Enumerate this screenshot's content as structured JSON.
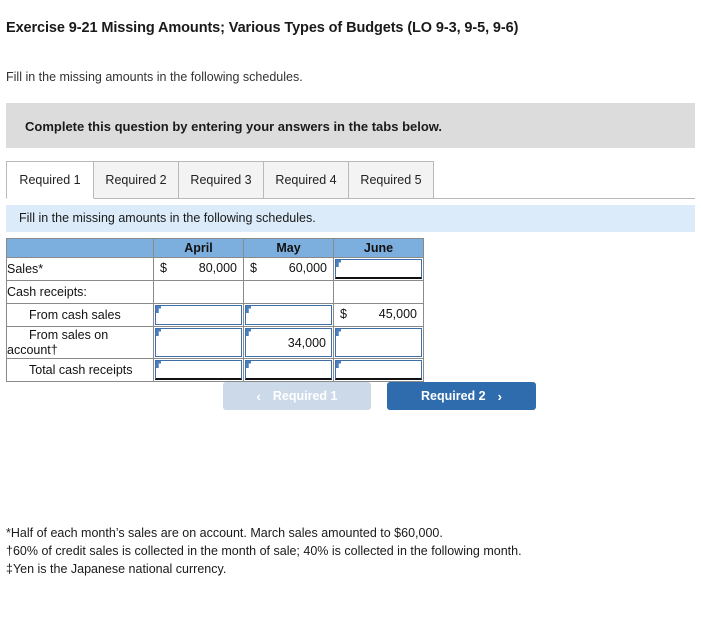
{
  "page": {
    "title": "Exercise 9-21 Missing Amounts; Various Types of Budgets (LO 9-3, 9-5, 9-6)",
    "subtitle": "Fill in the missing amounts in the following schedules."
  },
  "gray_banner": {
    "text": "Complete this question by entering your answers in the tabs below."
  },
  "tabs": [
    {
      "label": "Required 1",
      "active": true
    },
    {
      "label": "Required 2",
      "active": false
    },
    {
      "label": "Required 3",
      "active": false
    },
    {
      "label": "Required 4",
      "active": false
    },
    {
      "label": "Required 5",
      "active": false
    }
  ],
  "blue_bar": {
    "text": "Fill in the missing amounts in the following schedules."
  },
  "table": {
    "headers": [
      "",
      "April",
      "May",
      "June"
    ],
    "rows": [
      {
        "label": "Sales*",
        "indent": false,
        "cells": [
          {
            "kind": "static",
            "currency": "$",
            "value": "80,000"
          },
          {
            "kind": "static",
            "currency": "$",
            "value": "60,000"
          },
          {
            "kind": "input",
            "currency": "",
            "value": ""
          }
        ]
      },
      {
        "label": "Cash receipts:",
        "indent": false,
        "cells": [
          {
            "kind": "blank",
            "currency": "",
            "value": ""
          },
          {
            "kind": "blank",
            "currency": "",
            "value": ""
          },
          {
            "kind": "blank",
            "currency": "",
            "value": ""
          }
        ]
      },
      {
        "label": "From cash sales",
        "indent": true,
        "cells": [
          {
            "kind": "input",
            "currency": "",
            "value": ""
          },
          {
            "kind": "input",
            "currency": "",
            "value": ""
          },
          {
            "kind": "static",
            "currency": "$",
            "value": "45,000"
          }
        ]
      },
      {
        "label_line1": "From sales on",
        "label_line2": "account†",
        "indent": true,
        "wrap": true,
        "cells": [
          {
            "kind": "input",
            "currency": "",
            "value": ""
          },
          {
            "kind": "input",
            "currency": "",
            "value": "34,000"
          },
          {
            "kind": "input",
            "currency": "",
            "value": ""
          }
        ]
      },
      {
        "label": "Total cash receipts",
        "indent": true,
        "cells": [
          {
            "kind": "input",
            "currency": "",
            "value": ""
          },
          {
            "kind": "input",
            "currency": "",
            "value": ""
          },
          {
            "kind": "input",
            "currency": "",
            "value": ""
          }
        ]
      }
    ]
  },
  "nav": {
    "prev_label": "Required 1",
    "prev_icon": "chevron-left-icon",
    "prev_glyph": "‹",
    "next_label": "Required 2",
    "next_icon": "chevron-right-icon",
    "next_glyph": "›"
  },
  "footnotes": [
    "*Half of each month’s sales are on account. March sales amounted to $60,000.",
    "†60% of credit sales is collected in the month of sale; 40% is collected in the following month.",
    "‡Yen is the Japanese national currency."
  ],
  "colors": {
    "header_blue": "#7dafde",
    "blue_bar": "#dbebfa",
    "gray_banner": "#dcdcdc",
    "input_border": "#3f6fa8",
    "nav_active": "#2e6cad",
    "nav_disabled": "#ccd9e8"
  }
}
